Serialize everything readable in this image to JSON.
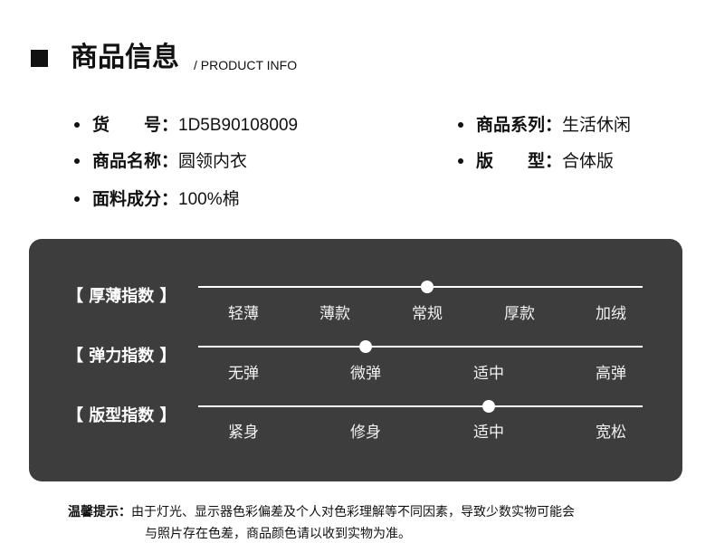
{
  "header": {
    "title": "商品信息",
    "subtitle": "/ PRODUCT INFO"
  },
  "info": {
    "item_no": {
      "label": "货　　号：",
      "value": "1D5B90108009"
    },
    "series": {
      "label": "商品系列：",
      "value": "生活休闲"
    },
    "name": {
      "label": "商品名称：",
      "value": "圆领内衣"
    },
    "fit": {
      "label": "版　　型：",
      "value": "合体版"
    },
    "fabric": {
      "label": "面料成分：",
      "value": "100%棉"
    }
  },
  "indices": [
    {
      "label": "【 厚薄指数 】",
      "ticks": [
        "轻薄",
        "薄款",
        "常规",
        "厚款",
        "加绒"
      ],
      "selected_index": 2
    },
    {
      "label": "【 弹力指数 】",
      "ticks": [
        "无弹",
        "微弹",
        "适中",
        "高弹"
      ],
      "selected_index": 1
    },
    {
      "label": "【 版型指数 】",
      "ticks": [
        "紧身",
        "修身",
        "适中",
        "宽松"
      ],
      "selected_index": 2
    }
  ],
  "notice": {
    "label": "温馨提示：",
    "line1": "由于灯光、显示器色彩偏差及个人对色彩理解等不同因素，导致少数实物可能会",
    "line2": "与照片存在色差，商品颜色请以收到实物为准。"
  }
}
